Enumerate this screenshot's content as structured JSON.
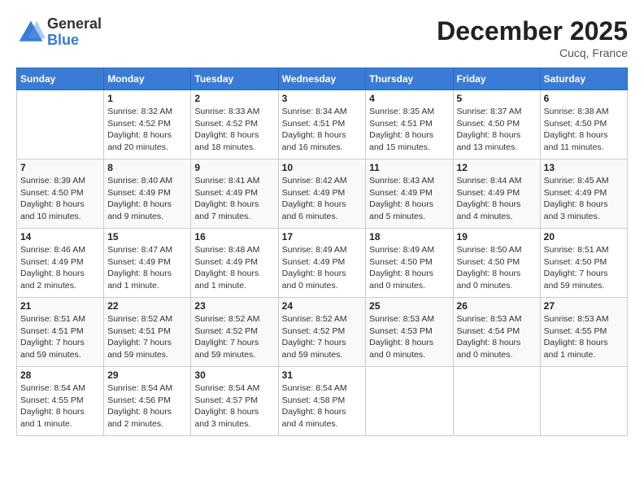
{
  "logo": {
    "general": "General",
    "blue": "Blue"
  },
  "header": {
    "month": "December 2025",
    "location": "Cucq, France"
  },
  "days_of_week": [
    "Sunday",
    "Monday",
    "Tuesday",
    "Wednesday",
    "Thursday",
    "Friday",
    "Saturday"
  ],
  "weeks": [
    [
      {
        "day": "",
        "info": ""
      },
      {
        "day": "1",
        "info": "Sunrise: 8:32 AM\nSunset: 4:52 PM\nDaylight: 8 hours\nand 20 minutes."
      },
      {
        "day": "2",
        "info": "Sunrise: 8:33 AM\nSunset: 4:52 PM\nDaylight: 8 hours\nand 18 minutes."
      },
      {
        "day": "3",
        "info": "Sunrise: 8:34 AM\nSunset: 4:51 PM\nDaylight: 8 hours\nand 16 minutes."
      },
      {
        "day": "4",
        "info": "Sunrise: 8:35 AM\nSunset: 4:51 PM\nDaylight: 8 hours\nand 15 minutes."
      },
      {
        "day": "5",
        "info": "Sunrise: 8:37 AM\nSunset: 4:50 PM\nDaylight: 8 hours\nand 13 minutes."
      },
      {
        "day": "6",
        "info": "Sunrise: 8:38 AM\nSunset: 4:50 PM\nDaylight: 8 hours\nand 11 minutes."
      }
    ],
    [
      {
        "day": "7",
        "info": "Sunrise: 8:39 AM\nSunset: 4:50 PM\nDaylight: 8 hours\nand 10 minutes."
      },
      {
        "day": "8",
        "info": "Sunrise: 8:40 AM\nSunset: 4:49 PM\nDaylight: 8 hours\nand 9 minutes."
      },
      {
        "day": "9",
        "info": "Sunrise: 8:41 AM\nSunset: 4:49 PM\nDaylight: 8 hours\nand 7 minutes."
      },
      {
        "day": "10",
        "info": "Sunrise: 8:42 AM\nSunset: 4:49 PM\nDaylight: 8 hours\nand 6 minutes."
      },
      {
        "day": "11",
        "info": "Sunrise: 8:43 AM\nSunset: 4:49 PM\nDaylight: 8 hours\nand 5 minutes."
      },
      {
        "day": "12",
        "info": "Sunrise: 8:44 AM\nSunset: 4:49 PM\nDaylight: 8 hours\nand 4 minutes."
      },
      {
        "day": "13",
        "info": "Sunrise: 8:45 AM\nSunset: 4:49 PM\nDaylight: 8 hours\nand 3 minutes."
      }
    ],
    [
      {
        "day": "14",
        "info": "Sunrise: 8:46 AM\nSunset: 4:49 PM\nDaylight: 8 hours\nand 2 minutes."
      },
      {
        "day": "15",
        "info": "Sunrise: 8:47 AM\nSunset: 4:49 PM\nDaylight: 8 hours\nand 1 minute."
      },
      {
        "day": "16",
        "info": "Sunrise: 8:48 AM\nSunset: 4:49 PM\nDaylight: 8 hours\nand 1 minute."
      },
      {
        "day": "17",
        "info": "Sunrise: 8:49 AM\nSunset: 4:49 PM\nDaylight: 8 hours\nand 0 minutes."
      },
      {
        "day": "18",
        "info": "Sunrise: 8:49 AM\nSunset: 4:50 PM\nDaylight: 8 hours\nand 0 minutes."
      },
      {
        "day": "19",
        "info": "Sunrise: 8:50 AM\nSunset: 4:50 PM\nDaylight: 8 hours\nand 0 minutes."
      },
      {
        "day": "20",
        "info": "Sunrise: 8:51 AM\nSunset: 4:50 PM\nDaylight: 7 hours\nand 59 minutes."
      }
    ],
    [
      {
        "day": "21",
        "info": "Sunrise: 8:51 AM\nSunset: 4:51 PM\nDaylight: 7 hours\nand 59 minutes."
      },
      {
        "day": "22",
        "info": "Sunrise: 8:52 AM\nSunset: 4:51 PM\nDaylight: 7 hours\nand 59 minutes."
      },
      {
        "day": "23",
        "info": "Sunrise: 8:52 AM\nSunset: 4:52 PM\nDaylight: 7 hours\nand 59 minutes."
      },
      {
        "day": "24",
        "info": "Sunrise: 8:52 AM\nSunset: 4:52 PM\nDaylight: 7 hours\nand 59 minutes."
      },
      {
        "day": "25",
        "info": "Sunrise: 8:53 AM\nSunset: 4:53 PM\nDaylight: 8 hours\nand 0 minutes."
      },
      {
        "day": "26",
        "info": "Sunrise: 8:53 AM\nSunset: 4:54 PM\nDaylight: 8 hours\nand 0 minutes."
      },
      {
        "day": "27",
        "info": "Sunrise: 8:53 AM\nSunset: 4:55 PM\nDaylight: 8 hours\nand 1 minute."
      }
    ],
    [
      {
        "day": "28",
        "info": "Sunrise: 8:54 AM\nSunset: 4:55 PM\nDaylight: 8 hours\nand 1 minute."
      },
      {
        "day": "29",
        "info": "Sunrise: 8:54 AM\nSunset: 4:56 PM\nDaylight: 8 hours\nand 2 minutes."
      },
      {
        "day": "30",
        "info": "Sunrise: 8:54 AM\nSunset: 4:57 PM\nDaylight: 8 hours\nand 3 minutes."
      },
      {
        "day": "31",
        "info": "Sunrise: 8:54 AM\nSunset: 4:58 PM\nDaylight: 8 hours\nand 4 minutes."
      },
      {
        "day": "",
        "info": ""
      },
      {
        "day": "",
        "info": ""
      },
      {
        "day": "",
        "info": ""
      }
    ]
  ]
}
